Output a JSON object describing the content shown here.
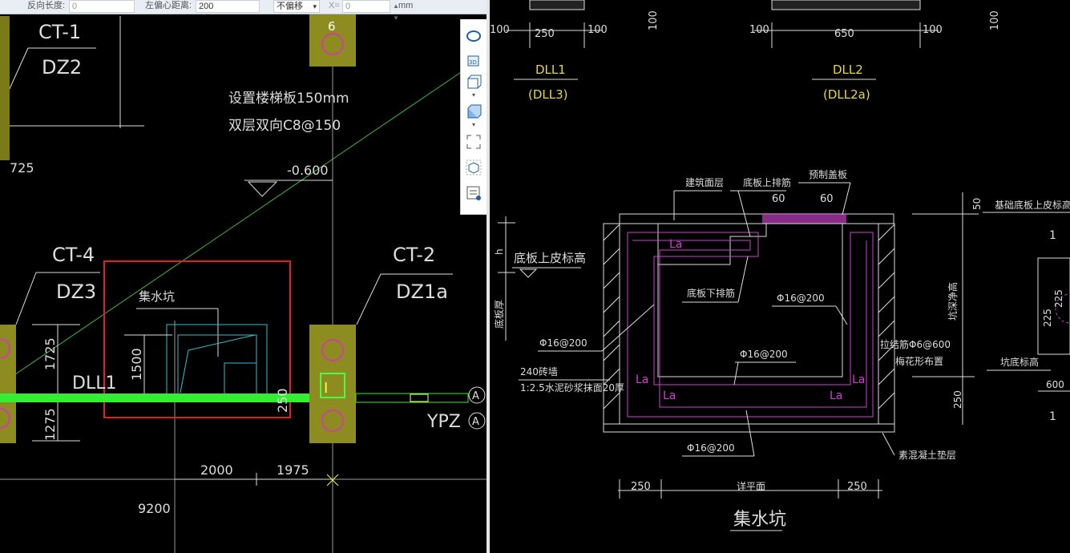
{
  "toolbar": {
    "reverse_length_label": "反向长度:",
    "reverse_length_value": "0",
    "left_offset_label": "左偏心距离:",
    "left_offset_value": "200",
    "offset_mode": "不偏移",
    "x_label": "X=",
    "x_value": "0",
    "unit": "mm"
  },
  "left_drawing": {
    "ct1": "CT-1",
    "dz2": "DZ2",
    "col_num": "6",
    "note_line1": "设置楼梯板150mm",
    "note_line2": "双层双向C8@150",
    "dim_725": "725",
    "elev": "-0.600",
    "ct4": "CT-4",
    "dz3": "DZ3",
    "ct2": "CT-2",
    "dz1a": "DZ1a",
    "sump_label": "集水坑",
    "dim_1725": "1725",
    "dim_1500": "1500",
    "dll1": "DLL1",
    "dim_250": "250",
    "dim_1275": "1275",
    "ypz": "YPZ",
    "axis_a1": "A",
    "axis_a2": "A",
    "dim_2000": "2000",
    "dim_1975": "1975",
    "dim_9200": "9200"
  },
  "right_drawing": {
    "d_100a": "100",
    "d_250": "250",
    "d_100b": "100",
    "d_100c": "100",
    "d_100d": "100",
    "d_650": "650",
    "d_100e": "100",
    "d_100f": "100",
    "dll1": "DLL1",
    "dll3": "(DLL3)",
    "dll2": "DLL2",
    "dll2a": "(DLL2a)",
    "finish_layer": "建筑面层",
    "top_bar": "底板上排筋",
    "precast": "预制盖板",
    "d60a": "60",
    "d60b": "60",
    "d50": "50",
    "base_top_elev": "基础底板上皮标高",
    "h": "h",
    "slab_top_elev": "底板上皮标高",
    "la1": "La",
    "bottom_bar": "底板下排筋",
    "slab_thick": "底板厚",
    "phi16_200a": "Φ16@200",
    "phi16_200b": "Φ16@200",
    "tie_bar": "拉结筋Φ6@600",
    "plum_layout": "梅花形布置",
    "pit_depth": "坑深净高",
    "phi16_200c": "Φ16@200",
    "brick_wall": "240砖墙",
    "mortar": "1:2.5水泥砂浆抹面20厚",
    "pit_bottom_elev": "坑底标高",
    "la2": "La",
    "la3": "La",
    "la4": "La",
    "la5": "La",
    "d250v": "250",
    "phi16_200d": "Φ16@200",
    "concrete_cushion": "素混凝土垫层",
    "d250a": "250",
    "plan_detail": "详平面",
    "d250b": "250",
    "title": "集水坑",
    "d225a": "225",
    "d225b": "225",
    "d600": "600",
    "one_a": "1",
    "one_b": "1"
  }
}
